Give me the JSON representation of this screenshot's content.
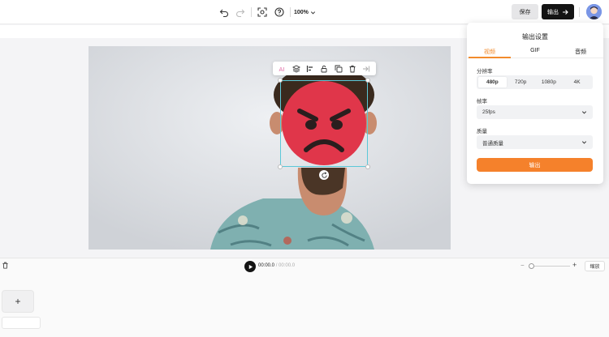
{
  "toolbar": {
    "zoom_level": "100%",
    "save_label": "保存",
    "export_label": "输出"
  },
  "element_toolbar": {
    "ai_label": "AI"
  },
  "export_panel": {
    "title": "输出设置",
    "tabs": [
      "视频",
      "GIF",
      "音频"
    ],
    "active_tab": "视频",
    "resolution_label": "分辨率",
    "resolutions": [
      "480p",
      "720p",
      "1080p",
      "4K"
    ],
    "selected_resolution": "480p",
    "framerate_label": "帧率",
    "framerate_value": "25fps",
    "quality_label": "质量",
    "quality_value": "普通质量",
    "export_button": "输出"
  },
  "timeline": {
    "current_time": "00:00.0",
    "separator": "/",
    "duration": "00:00.0",
    "fit_label": "缩放",
    "add_label": "+",
    "zoom_minus": "−",
    "zoom_plus": "+"
  },
  "colors": {
    "accent": "#f5812b",
    "dark_button": "#141414",
    "selection": "#5cc8d8",
    "emoji_red": "#e0364a"
  }
}
